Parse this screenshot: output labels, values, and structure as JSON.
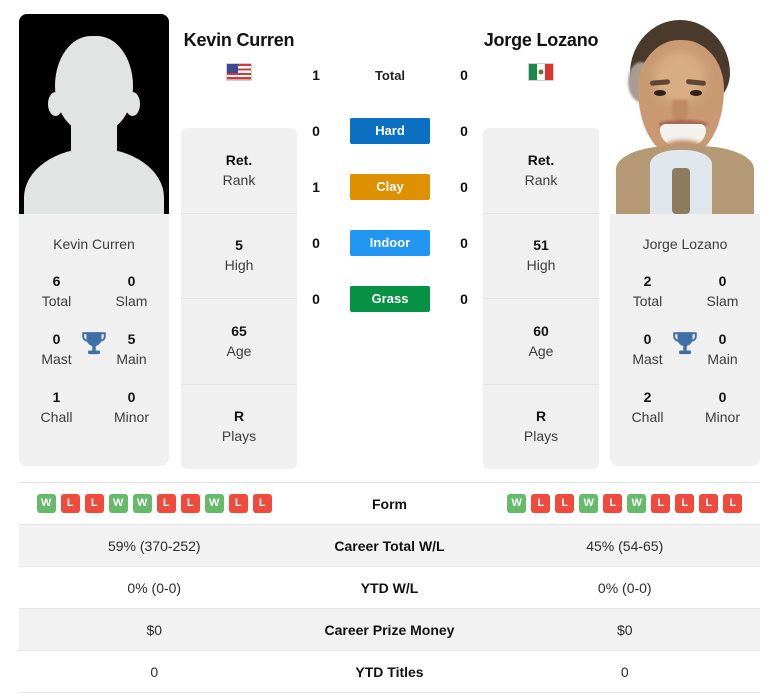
{
  "players": {
    "left": {
      "name": "Kevin Curren",
      "flag": "us-flag-icon",
      "photo_caption": "Kevin Curren",
      "photo_type": "placeholder-avatar-icon",
      "info": [
        {
          "value": "Ret.",
          "label": "Rank"
        },
        {
          "value": "5",
          "label": "High"
        },
        {
          "value": "65",
          "label": "Age"
        },
        {
          "value": "R",
          "label": "Plays"
        }
      ],
      "titles": [
        {
          "value": "6",
          "label": "Total"
        },
        {
          "value": "0",
          "label": "Slam"
        },
        {
          "value": "0",
          "label": "Mast"
        },
        {
          "value": "5",
          "label": "Main"
        },
        {
          "value": "1",
          "label": "Chall"
        },
        {
          "value": "0",
          "label": "Minor"
        }
      ],
      "form": [
        "W",
        "L",
        "L",
        "W",
        "W",
        "L",
        "L",
        "W",
        "L",
        "L"
      ],
      "career_total_wl": "59% (370-252)",
      "ytd_wl": "0% (0-0)",
      "career_prize_money": "$0",
      "ytd_titles": "0"
    },
    "right": {
      "name": "Jorge Lozano",
      "flag": "mx-flag-icon",
      "photo_caption": "Jorge Lozano",
      "photo_type": "portrait-photo",
      "info": [
        {
          "value": "Ret.",
          "label": "Rank"
        },
        {
          "value": "51",
          "label": "High"
        },
        {
          "value": "60",
          "label": "Age"
        },
        {
          "value": "R",
          "label": "Plays"
        }
      ],
      "titles": [
        {
          "value": "2",
          "label": "Total"
        },
        {
          "value": "0",
          "label": "Slam"
        },
        {
          "value": "0",
          "label": "Mast"
        },
        {
          "value": "0",
          "label": "Main"
        },
        {
          "value": "2",
          "label": "Chall"
        },
        {
          "value": "0",
          "label": "Minor"
        }
      ],
      "form": [
        "W",
        "L",
        "L",
        "W",
        "L",
        "W",
        "L",
        "L",
        "L",
        "L"
      ],
      "career_total_wl": "45% (54-65)",
      "ytd_wl": "0% (0-0)",
      "career_prize_money": "$0",
      "ytd_titles": "0"
    }
  },
  "h2h": [
    {
      "label": "Total",
      "left": "1",
      "right": "0",
      "badge": false,
      "color": ""
    },
    {
      "label": "Hard",
      "left": "0",
      "right": "0",
      "badge": true,
      "color": "#0c70c2"
    },
    {
      "label": "Clay",
      "left": "1",
      "right": "0",
      "badge": true,
      "color": "#dd9000"
    },
    {
      "label": "Indoor",
      "left": "0",
      "right": "0",
      "badge": true,
      "color": "#2196f3"
    },
    {
      "label": "Grass",
      "left": "0",
      "right": "0",
      "badge": true,
      "color": "#079145"
    }
  ],
  "table_labels": {
    "form": "Form",
    "career_total_wl": "Career Total W/L",
    "ytd_wl": "YTD W/L",
    "career_prize_money": "Career Prize Money",
    "ytd_titles": "YTD Titles"
  },
  "colors": {
    "win_badge": "#66bb6a",
    "loss_badge": "#f04a3c",
    "card_bg": "#f0f0f0",
    "trophy": "#3e6fa8"
  }
}
